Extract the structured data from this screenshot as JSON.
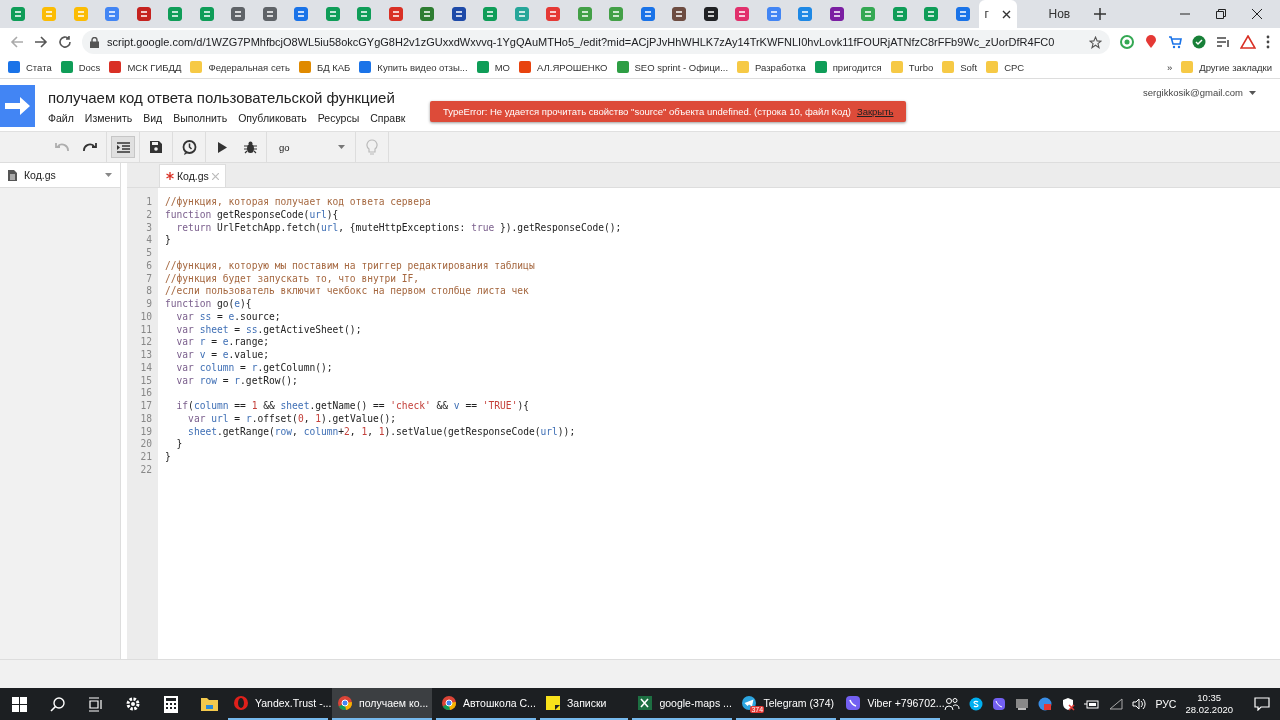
{
  "browser": {
    "tabs": [
      {
        "color": "#0f9d58"
      },
      {
        "color": "#fbbc04"
      },
      {
        "color": "#fbbc04"
      },
      {
        "color": "#4285f4"
      },
      {
        "color": "#c5221f"
      },
      {
        "color": "#0f9d58"
      },
      {
        "color": "#0f9d58"
      },
      {
        "color": "#5f6368"
      },
      {
        "color": "#5f6368"
      },
      {
        "color": "#1a73e8"
      },
      {
        "color": "#0f9d58"
      },
      {
        "color": "#0f9d58"
      },
      {
        "color": "#d93025"
      },
      {
        "color": "#2e7d32"
      },
      {
        "color": "#1e4aa8"
      },
      {
        "color": "#0f9d58"
      },
      {
        "color": "#26a69a"
      },
      {
        "color": "#e53935"
      },
      {
        "color": "#43a047"
      },
      {
        "color": "#43a047"
      },
      {
        "color": "#1a73e8"
      },
      {
        "color": "#6d4c41"
      },
      {
        "color": "#202124"
      },
      {
        "color": "#e1306c"
      },
      {
        "color": "#4285f4"
      },
      {
        "color": "#1e88e5"
      },
      {
        "color": "#7b1fa2"
      },
      {
        "color": "#34a853"
      },
      {
        "color": "#0f9d58"
      },
      {
        "color": "#0f9d58"
      },
      {
        "color": "#1a73e8"
      }
    ],
    "active_tab": {
      "label": "г"
    },
    "new_tab": {
      "label": "Нов"
    },
    "address": "script.google.com/d/1WZG7PMhfbcjO8WL5iu58okcGYgG8H2v1zGUxxdWxvvq-1YgQAuMTHo5_/edit?mid=ACjPJvHhWHLK7zAy14TrKWFNLI0hvLovk11fFOURjATNfzC8rFFb9Wc_zUorDfR4FC0",
    "bookmarks": [
      {
        "label": "Стата",
        "color": "#1a73e8"
      },
      {
        "label": "Docs",
        "color": "#0f9d58"
      },
      {
        "label": "МСК ГИБДД",
        "color": "#d93025"
      },
      {
        "label": "Федеральная сеть",
        "color": "#f6c945"
      },
      {
        "label": "БД КАБ",
        "color": "#e08a00"
      },
      {
        "label": "Купить видео отзы...",
        "color": "#1a73e8"
      },
      {
        "label": "МО",
        "color": "#0f9d58"
      },
      {
        "label": "АЛ.ЯРОШЕНКО",
        "color": "#e8430e"
      },
      {
        "label": "SEO sprint - Офици...",
        "color": "#2e9e44"
      },
      {
        "label": "Разработка",
        "color": "#f6c945"
      },
      {
        "label": "пригодится",
        "color": "#0f9d58"
      },
      {
        "label": "Turbo",
        "color": "#f6c945"
      },
      {
        "label": "Soft",
        "color": "#f6c945"
      },
      {
        "label": "CPC",
        "color": "#f6c945"
      }
    ],
    "more": "»",
    "other_bookmarks": "Другие закладки"
  },
  "app": {
    "title": "получаем код ответа пользовательской функцией",
    "menu": [
      "Файл",
      "Изменить",
      "Вид",
      "Выполнить",
      "Опубликовать",
      "Ресурсы",
      "Справк"
    ],
    "account": "sergikkosik@gmail.com",
    "error": {
      "message": "TypeError: Не удается прочитать свойство \"source\" объекта undefined. (строка 10, файл Код)",
      "action": "Закрыть"
    }
  },
  "toolbar": {
    "undo": {
      "disabled": true
    },
    "redo": {
      "disabled": false
    },
    "indent": {
      "selected": true
    },
    "function": "go",
    "hint": {
      "disabled": true
    }
  },
  "sidebar": {
    "file": "Код.gs"
  },
  "editor_tab": {
    "label": "Код.gs",
    "modified": true
  },
  "code": [
    {
      "number": "1",
      "tokens": [
        {
          "text": "//функция, которая получает код ответа сервера",
          "kind": "comment"
        }
      ]
    },
    {
      "number": "2",
      "tokens": [
        {
          "text": "function ",
          "kind": "keyword"
        },
        {
          "text": "getResponseCode(",
          "kind": "plain"
        },
        {
          "text": "url",
          "kind": "variable"
        },
        {
          "text": "){",
          "kind": "plain"
        }
      ]
    },
    {
      "number": "3",
      "tokens": [
        {
          "text": "  return ",
          "kind": "keyword"
        },
        {
          "text": "UrlFetchApp.fetch(",
          "kind": "plain"
        },
        {
          "text": "url",
          "kind": "variable"
        },
        {
          "text": ", {muteHttpExceptions: ",
          "kind": "plain"
        },
        {
          "text": "true",
          "kind": "keyword"
        },
        {
          "text": " }).getResponseCode();",
          "kind": "plain"
        }
      ]
    },
    {
      "number": "4",
      "tokens": [
        {
          "text": "}",
          "kind": "plain"
        }
      ]
    },
    {
      "number": "5"
    },
    {
      "number": "6",
      "tokens": [
        {
          "text": "//функция, которую мы поставим на триггер редактирования таблицы",
          "kind": "comment"
        }
      ]
    },
    {
      "number": "7",
      "tokens": [
        {
          "text": "//функция будет запускать то, что внутри IF,",
          "kind": "comment"
        }
      ]
    },
    {
      "number": "8",
      "tokens": [
        {
          "text": "//если пользователь включит чекбокс на первом столбце листа чек",
          "kind": "comment"
        }
      ]
    },
    {
      "number": "9",
      "tokens": [
        {
          "text": "function ",
          "kind": "keyword"
        },
        {
          "text": "go(",
          "kind": "plain"
        },
        {
          "text": "e",
          "kind": "variable"
        },
        {
          "text": "){",
          "kind": "plain"
        }
      ]
    },
    {
      "number": "10",
      "tokens": [
        {
          "text": "  var ",
          "kind": "keyword"
        },
        {
          "text": "ss",
          "kind": "variable"
        },
        {
          "text": " = ",
          "kind": "plain"
        },
        {
          "text": "e",
          "kind": "variable"
        },
        {
          "text": ".source;",
          "kind": "plain"
        }
      ]
    },
    {
      "number": "11",
      "tokens": [
        {
          "text": "  var ",
          "kind": "keyword"
        },
        {
          "text": "sheet",
          "kind": "variable"
        },
        {
          "text": " = ",
          "kind": "plain"
        },
        {
          "text": "ss",
          "kind": "variable"
        },
        {
          "text": ".getActiveSheet();",
          "kind": "plain"
        }
      ]
    },
    {
      "number": "12",
      "tokens": [
        {
          "text": "  var ",
          "kind": "keyword"
        },
        {
          "text": "r",
          "kind": "variable"
        },
        {
          "text": " = ",
          "kind": "plain"
        },
        {
          "text": "e",
          "kind": "variable"
        },
        {
          "text": ".range;",
          "kind": "plain"
        }
      ]
    },
    {
      "number": "13",
      "tokens": [
        {
          "text": "  var ",
          "kind": "keyword"
        },
        {
          "text": "v",
          "kind": "variable"
        },
        {
          "text": " = ",
          "kind": "plain"
        },
        {
          "text": "e",
          "kind": "variable"
        },
        {
          "text": ".value;",
          "kind": "plain"
        }
      ]
    },
    {
      "number": "14",
      "tokens": [
        {
          "text": "  var ",
          "kind": "keyword"
        },
        {
          "text": "column",
          "kind": "variable"
        },
        {
          "text": " = ",
          "kind": "plain"
        },
        {
          "text": "r",
          "kind": "variable"
        },
        {
          "text": ".getColumn();",
          "kind": "plain"
        }
      ]
    },
    {
      "number": "15",
      "tokens": [
        {
          "text": "  var ",
          "kind": "keyword"
        },
        {
          "text": "row",
          "kind": "variable"
        },
        {
          "text": " = ",
          "kind": "plain"
        },
        {
          "text": "r",
          "kind": "variable"
        },
        {
          "text": ".getRow();",
          "kind": "plain"
        }
      ]
    },
    {
      "number": "16"
    },
    {
      "number": "17",
      "tokens": [
        {
          "text": "  if",
          "kind": "keyword"
        },
        {
          "text": "(",
          "kind": "plain"
        },
        {
          "text": "column",
          "kind": "variable"
        },
        {
          "text": " == ",
          "kind": "plain"
        },
        {
          "text": "1",
          "kind": "number"
        },
        {
          "text": " && ",
          "kind": "plain"
        },
        {
          "text": "sheet",
          "kind": "variable"
        },
        {
          "text": ".getName() == ",
          "kind": "plain"
        },
        {
          "text": "'check'",
          "kind": "string"
        },
        {
          "text": " && ",
          "kind": "plain"
        },
        {
          "text": "v",
          "kind": "variable"
        },
        {
          "text": " == ",
          "kind": "plain"
        },
        {
          "text": "'TRUE'",
          "kind": "string"
        },
        {
          "text": "){",
          "kind": "plain"
        }
      ]
    },
    {
      "number": "18",
      "tokens": [
        {
          "text": "    var ",
          "kind": "keyword"
        },
        {
          "text": "url",
          "kind": "variable"
        },
        {
          "text": " = ",
          "kind": "plain"
        },
        {
          "text": "r",
          "kind": "variable"
        },
        {
          "text": ".offset(",
          "kind": "plain"
        },
        {
          "text": "0",
          "kind": "number"
        },
        {
          "text": ", ",
          "kind": "plain"
        },
        {
          "text": "1",
          "kind": "number"
        },
        {
          "text": ").getValue();",
          "kind": "plain"
        }
      ]
    },
    {
      "number": "19",
      "tokens": [
        {
          "text": "    sheet",
          "kind": "variable"
        },
        {
          "text": ".getRange(",
          "kind": "plain"
        },
        {
          "text": "row",
          "kind": "variable"
        },
        {
          "text": ", ",
          "kind": "plain"
        },
        {
          "text": "column",
          "kind": "variable"
        },
        {
          "text": "+",
          "kind": "plain"
        },
        {
          "text": "2",
          "kind": "number"
        },
        {
          "text": ", ",
          "kind": "plain"
        },
        {
          "text": "1",
          "kind": "number"
        },
        {
          "text": ", ",
          "kind": "plain"
        },
        {
          "text": "1",
          "kind": "number"
        },
        {
          "text": ").setValue(getResponseCode(",
          "kind": "plain"
        },
        {
          "text": "url",
          "kind": "variable"
        },
        {
          "text": "));",
          "kind": "plain"
        }
      ]
    },
    {
      "number": "20",
      "tokens": [
        {
          "text": "  }",
          "kind": "plain"
        }
      ]
    },
    {
      "number": "21",
      "tokens": [
        {
          "text": "}",
          "kind": "plain"
        }
      ]
    },
    {
      "number": "22"
    }
  ],
  "taskbar": {
    "apps": [
      {
        "label": "Yandex.Trust -...",
        "kind": "opera",
        "selected": false
      },
      {
        "label": "получаем ко...",
        "kind": "chrome",
        "selected": true
      },
      {
        "label": "Автошкола С...",
        "kind": "chrome",
        "selected": false
      },
      {
        "label": "Записки",
        "kind": "notes",
        "selected": false
      },
      {
        "label": "google-maps ...",
        "kind": "excel",
        "selected": false
      },
      {
        "label": "Telegram (374)",
        "kind": "telegram",
        "selected": false,
        "badge": "374"
      },
      {
        "label": "Viber +796702...",
        "kind": "viber",
        "selected": false
      }
    ],
    "language": "РУС",
    "time": "10:35",
    "date": "28.02.2020"
  }
}
